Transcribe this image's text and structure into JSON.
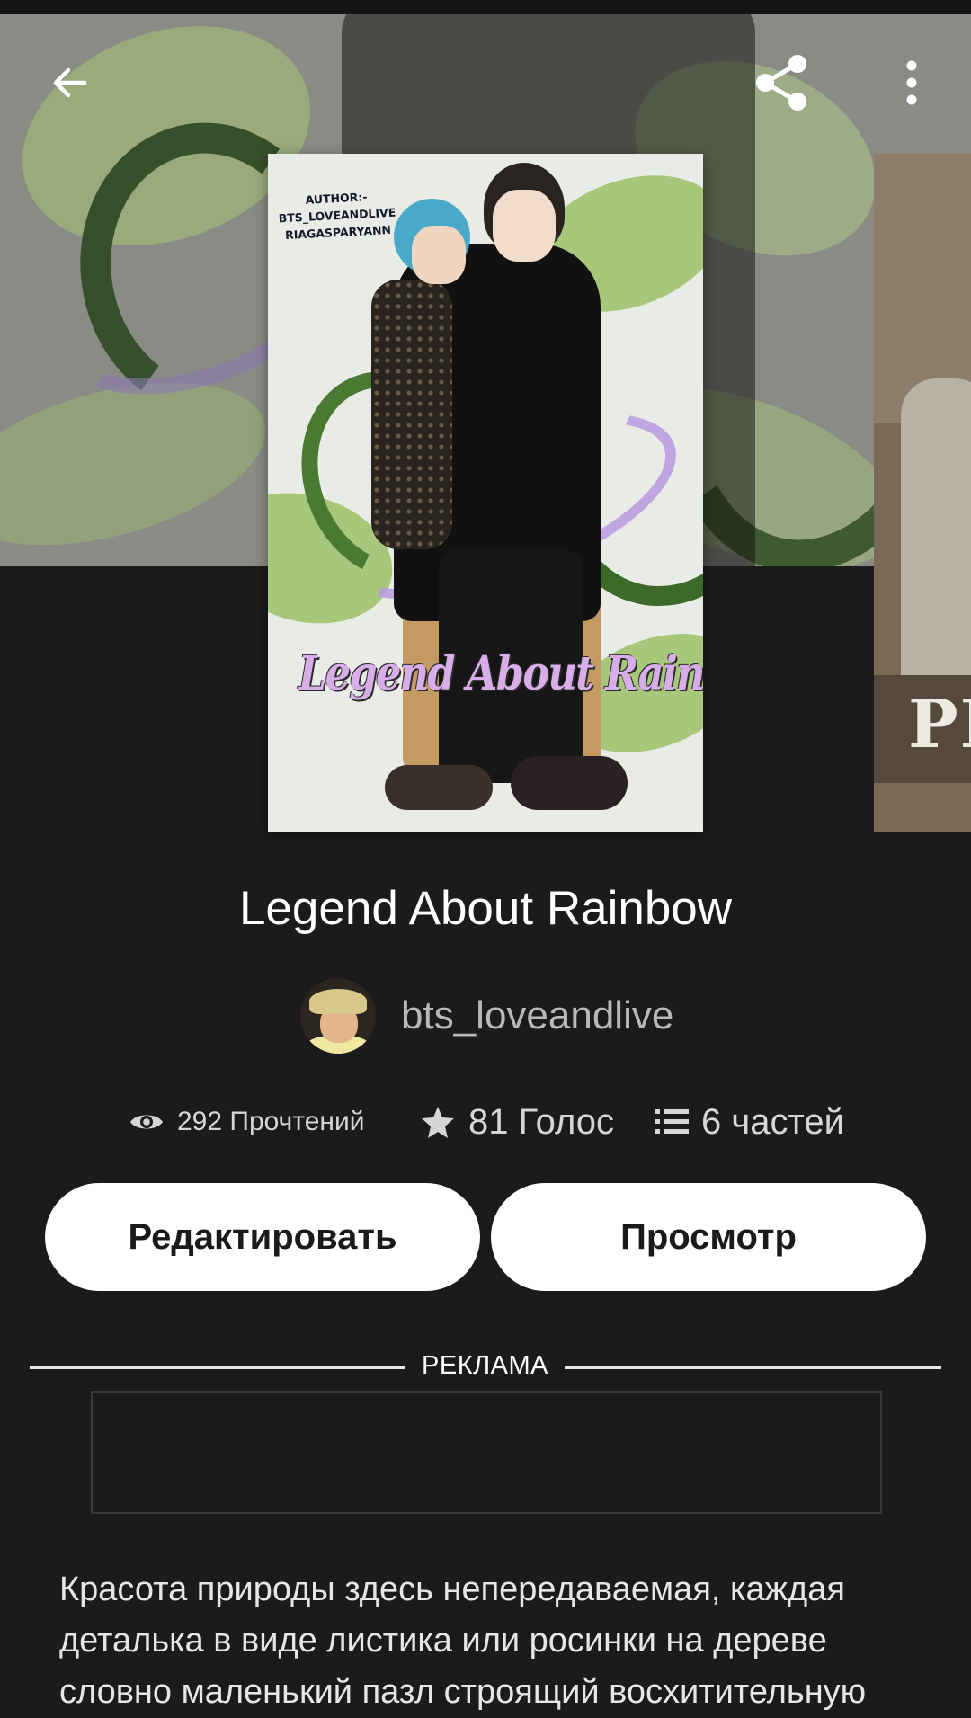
{
  "header": {
    "back_icon": "arrow-left-icon",
    "share_icon": "share-icon",
    "more_icon": "more-vertical-icon"
  },
  "cover": {
    "author_text_lines": [
      "AUTHOR:-",
      "BTS_LOVEANDLIVE",
      "RIAGASPARYANN"
    ],
    "title_art": "Legend About Rainbow",
    "next_cover_text": "PF"
  },
  "story": {
    "title": "Legend About Rainbow",
    "author": "bts_loveandlive"
  },
  "stats": {
    "reads": "292 Прочтений",
    "votes": "81 Голос",
    "parts": "6 частей",
    "reads_icon": "eye-icon",
    "votes_icon": "star-icon",
    "parts_icon": "list-icon"
  },
  "actions": {
    "edit_label": "Редактировать",
    "view_label": "Просмотр"
  },
  "ad": {
    "label": "РЕКЛАМА"
  },
  "description": "Красота природы здесь непередаваемая, каждая деталька в виде листика или росинки на дереве словно маленький пазл строящий восхитительную",
  "colors": {
    "background": "#1b1a1c",
    "button_bg": "#ffffff",
    "button_text": "#1a1a1a",
    "muted_text": "#b9b9bc"
  }
}
